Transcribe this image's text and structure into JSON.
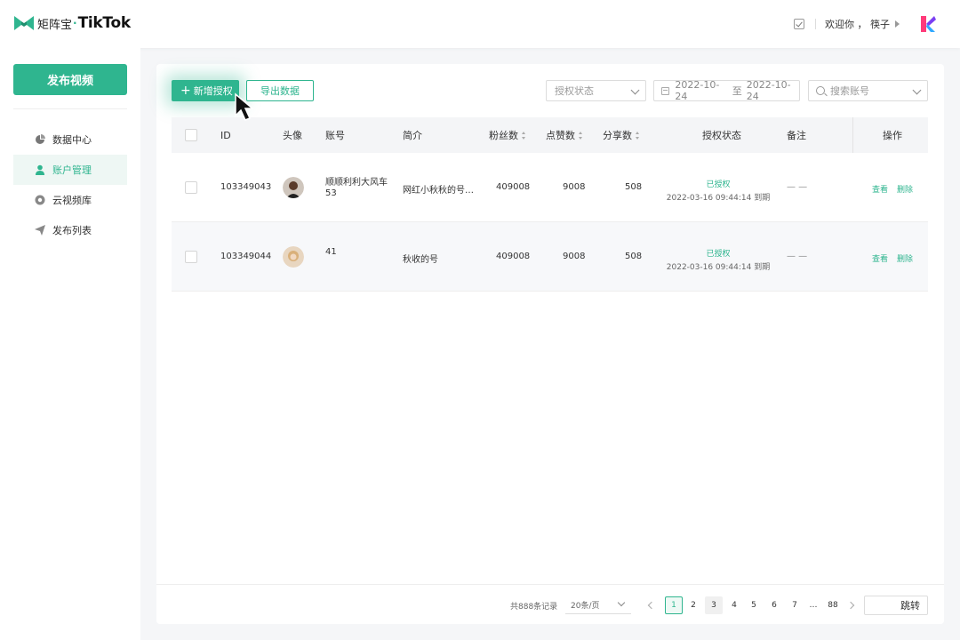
{
  "header": {
    "logo_cn": "矩阵宝",
    "logo_dot": "·",
    "logo_brand": "TikTok",
    "welcome": "欢迎你 ， 筷子"
  },
  "sidebar": {
    "publish_label": "发布视频",
    "items": [
      {
        "label": "数据中心",
        "icon": "pie-chart-icon"
      },
      {
        "label": "账户管理",
        "icon": "user-icon"
      },
      {
        "label": "云视频库",
        "icon": "cloud-video-icon"
      },
      {
        "label": "发布列表",
        "icon": "send-icon"
      }
    ]
  },
  "toolbar": {
    "add_label": "新增授权",
    "export_label": "导出数据",
    "status_placeholder": "授权状态",
    "date_from": "2022-10-24",
    "date_sep": "至",
    "date_to": "2022-10-24",
    "search_placeholder": "搜索账号"
  },
  "table": {
    "headers": {
      "id": "ID",
      "avatar": "头像",
      "account": "账号",
      "intro": "简介",
      "fans": "粉丝数",
      "likes": "点赞数",
      "shares": "分享数",
      "auth_status": "授权状态",
      "remark": "备注",
      "ops": "操作"
    },
    "rows": [
      {
        "id": "103349043",
        "account_line1": "顺顺利利大风车",
        "account_line2": "53",
        "intro": "网红小秋秋的号…",
        "fans": "409008",
        "likes": "9008",
        "shares": "508",
        "status": "已授权",
        "expire": "2022-03-16 09:44:14 到期",
        "remark": "— —",
        "view": "查看",
        "delete": "删除"
      },
      {
        "id": "103349044",
        "account_line1": "41",
        "account_line2": "",
        "intro": "秋收的号",
        "fans": "409008",
        "likes": "9008",
        "shares": "508",
        "status": "已授权",
        "expire": "2022-03-16 09:44:14 到期",
        "remark": "— —",
        "view": "查看",
        "delete": "删除"
      }
    ]
  },
  "pagination": {
    "total": "共888条记录",
    "page_size": "20条/页",
    "pages": [
      "1",
      "2",
      "3",
      "4",
      "5",
      "6",
      "7",
      "…",
      "88"
    ],
    "current": "1",
    "jump_label": "跳转"
  },
  "colors": {
    "accent": "#2fb58f"
  }
}
